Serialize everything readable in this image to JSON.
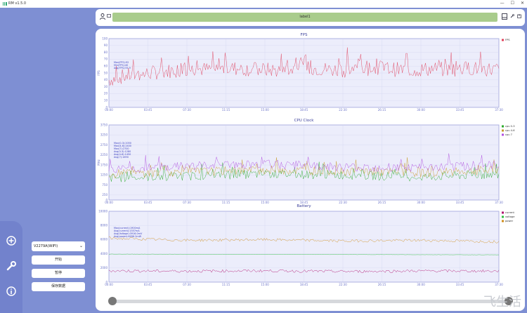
{
  "titlebar": {
    "app_title": "RM v1.5.0",
    "min": "—",
    "max": "☐",
    "close": "✕"
  },
  "topbar": {
    "label": "label1",
    "icons": [
      "person-icon",
      "monitor-icon",
      "save-icon",
      "wrench-icon",
      "export-icon"
    ]
  },
  "sidebar": {
    "device": "V2279A(WIFI)",
    "start_label": "开始",
    "pause_label": "暂停",
    "save_label": "保存数据",
    "rail_icons": [
      "plus-circle-icon",
      "wrench-icon",
      "info-icon"
    ]
  },
  "watermark": "飞生活",
  "colors": {
    "fps": "#e0405a",
    "cpu0": "#2aaa2a",
    "cpu4": "#c79b2a",
    "cpu7": "#b04fe0",
    "current": "#b0106e",
    "voltage": "#2fbf3f",
    "power": "#d08e1c",
    "axis": "#6a72c8",
    "plot_bg": "#ecedfb"
  },
  "chart_data": [
    {
      "type": "line",
      "title": "FPS",
      "ylabel": "FPS",
      "ylim": [
        0,
        100
      ],
      "yticks": [
        "0",
        "10",
        "20",
        "30",
        "40",
        "50",
        "60",
        "70",
        "80",
        "90",
        "100"
      ],
      "xticks": [
        "00:00",
        "03:45",
        "07:30",
        "11:15",
        "15:00",
        "18:45",
        "22:30",
        "26:15",
        "30:00",
        "33:45",
        "37:30"
      ],
      "legend_position": "top-right",
      "series": [
        {
          "name": "FPS",
          "values": [
            40,
            46,
            48,
            52,
            54,
            56,
            55,
            57,
            56,
            55,
            54,
            56,
            57,
            55,
            54,
            56,
            58,
            55,
            54,
            56,
            55,
            57,
            56,
            55
          ]
        }
      ],
      "annotation": [
        "Max(FPS):92",
        "Min(FPS):40",
        "Avg(FPS):55.9"
      ]
    },
    {
      "type": "line",
      "title": "CPU Clock",
      "ylabel": "MHz",
      "ylim": [
        0,
        3750
      ],
      "yticks": [
        "0",
        "250",
        "750",
        "1250",
        "1750",
        "2250",
        "2750",
        "3250",
        "3750"
      ],
      "xticks": [
        "00:00",
        "03:45",
        "07:30",
        "11:15",
        "15:00",
        "18:45",
        "22:30",
        "26:15",
        "30:00",
        "33:45",
        "37:30"
      ],
      "legend_position": "top-right",
      "series": [
        {
          "name": "cpu 0-3",
          "values": [
            1100,
            1200,
            1300,
            1250,
            1150,
            1300
          ]
        },
        {
          "name": "cpu 4-6",
          "values": [
            1300,
            1400,
            1500,
            1450,
            1350,
            1500
          ]
        },
        {
          "name": "cpu 7",
          "values": [
            1500,
            1700,
            1800,
            1650,
            1600,
            1750
          ]
        }
      ],
      "annotation": [
        "Max(0-3):2050",
        "Max(4-6):2400",
        "Max(7):2700",
        "Avg(0-3):1280",
        "Avg(4-6):1450",
        "Avg(7):1690"
      ]
    },
    {
      "type": "line",
      "title": "Battery",
      "ylim": [
        0,
        10000
      ],
      "yticks": [
        "0",
        "2000",
        "4000",
        "6000",
        "8000",
        "10000"
      ],
      "xticks": [
        "00:00",
        "03:45",
        "07:30",
        "11:15",
        "15:00",
        "18:45",
        "22:30",
        "26:15",
        "30:00",
        "33:45",
        "37:30"
      ],
      "legend_position": "top-right",
      "series": [
        {
          "name": "current",
          "values": [
            1600,
            1550,
            1600,
            1500,
            1580,
            1560
          ]
        },
        {
          "name": "voltage",
          "values": [
            3950,
            3930,
            3910,
            3890,
            3870,
            3850
          ]
        },
        {
          "name": "power",
          "values": [
            6200,
            5900,
            6000,
            5800,
            5900,
            5700
          ]
        }
      ],
      "annotation": [
        "Max(current):1900mA",
        "Avg(current):1557mA",
        "Avg(Voltage):3916.0mV",
        "Avg(power):6096.2mW"
      ]
    }
  ]
}
